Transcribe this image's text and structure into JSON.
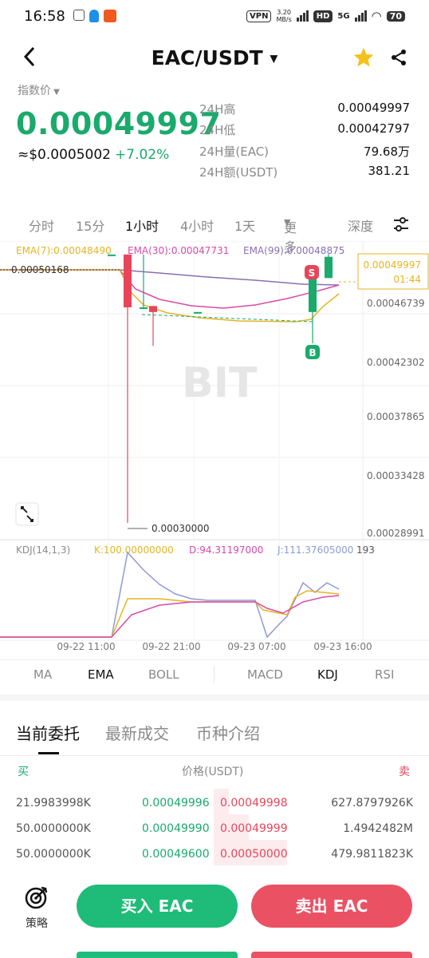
{
  "status_bar": {
    "time": "16:58",
    "vpn": "VPN",
    "speed_value": "3.20",
    "speed_unit": "MB/s",
    "hd": "HD",
    "net": "5G",
    "battery": "70"
  },
  "header": {
    "pair": "EAC/USDT"
  },
  "ticker": {
    "index_label": "指数价",
    "price": "0.00049997",
    "usd_price": "≈$0.0005002",
    "change": "+7.02%",
    "stats": [
      {
        "label": "24H高",
        "value": "0.00049997"
      },
      {
        "label": "24H低",
        "value": "0.00042797"
      },
      {
        "label": "24H量(EAC)",
        "value": "79.68万"
      },
      {
        "label": "24H额(USDT)",
        "value": "381.21"
      }
    ]
  },
  "timeframes": {
    "items": [
      "分时",
      "15分",
      "1小时",
      "4小时",
      "1天",
      "更多"
    ],
    "active": "1小时",
    "depth": "深度"
  },
  "chart_data": {
    "type": "candlestick",
    "ema_labels": {
      "ema7": "EMA(7):0.00048490",
      "ema30": "EMA(30):0.00047731",
      "ema99": "EMA(99):0.00048875"
    },
    "last_price_tag": {
      "price": "0.00049997",
      "countdown": "01:44"
    },
    "y_ticks": [
      "0.00046739",
      "0.00042302",
      "0.00037865",
      "0.00033428",
      "0.00028991"
    ],
    "y_range": [
      0.00028991,
      0.00051176
    ],
    "high_marker": "0.00050168",
    "low_marker": "0.00030000",
    "buy_marker": "B",
    "sell_marker": "S",
    "watermark": "BIT",
    "candles": [
      {
        "o": 0.00050168,
        "h": 0.00050168,
        "l": 0.00050168,
        "c": 0.00050168
      },
      {
        "o": 0.00050168,
        "h": 0.00050168,
        "l": 0.0003,
        "c": 0.000462
      },
      {
        "o": 0.000462,
        "h": 0.00050168,
        "l": 0.000462,
        "c": 0.000462
      },
      {
        "o": 0.000463,
        "h": 0.000463,
        "l": 0.000433,
        "c": 0.0004585
      },
      {
        "o": 0.0004585,
        "h": 0.0004585,
        "l": 0.0004585,
        "c": 0.0004585
      },
      {
        "o": 0.0004585,
        "h": 0.000491,
        "l": 0.000435,
        "c": 0.000484
      },
      {
        "o": 0.000484,
        "h": 0.000502,
        "l": 0.000484,
        "c": 0.00049997
      }
    ],
    "kdj": {
      "label": "KDJ(14,1,3)",
      "k": "K:100.00000000",
      "d": "D:94.31197000",
      "j": "J:111.37605000",
      "right_value": "193"
    },
    "x_ticks": [
      "09-22 11:00",
      "09-22 21:00",
      "09-23 07:00",
      "09-23 16:00"
    ],
    "colors": {
      "up": "#1aaa6c",
      "down": "#e8455b",
      "ema7": "#e6b422",
      "ema30": "#d94aa8",
      "ema99": "#8a6fb3",
      "j": "#8e9ad6"
    }
  },
  "indicators": {
    "main": [
      "MA",
      "EMA",
      "BOLL"
    ],
    "sub": [
      "MACD",
      "KDJ",
      "RSI"
    ],
    "active_main": "EMA",
    "active_sub": "KDJ"
  },
  "sections": {
    "tabs": [
      "当前委托",
      "最新成交",
      "币种介绍"
    ],
    "active": "当前委托"
  },
  "orderbook": {
    "buy_label": "买",
    "price_label": "价格(USDT)",
    "sell_label": "卖",
    "rows": [
      {
        "bid_qty": "21.9983998K",
        "bid_price": "0.00049996",
        "ask_price": "0.00049998",
        "ask_qty": "627.8797926K",
        "depth": 0.2
      },
      {
        "bid_qty": "50.0000000K",
        "bid_price": "0.00049990",
        "ask_price": "0.00049999",
        "ask_qty": "1.4942482M",
        "depth": 0.45
      },
      {
        "bid_qty": "50.0000000K",
        "bid_price": "0.00049600",
        "ask_price": "0.00050000",
        "ask_qty": "479.9811823K",
        "depth": 0.95
      }
    ]
  },
  "actions": {
    "strategy": "策略",
    "buy": "买入 EAC",
    "sell": "卖出 EAC"
  }
}
